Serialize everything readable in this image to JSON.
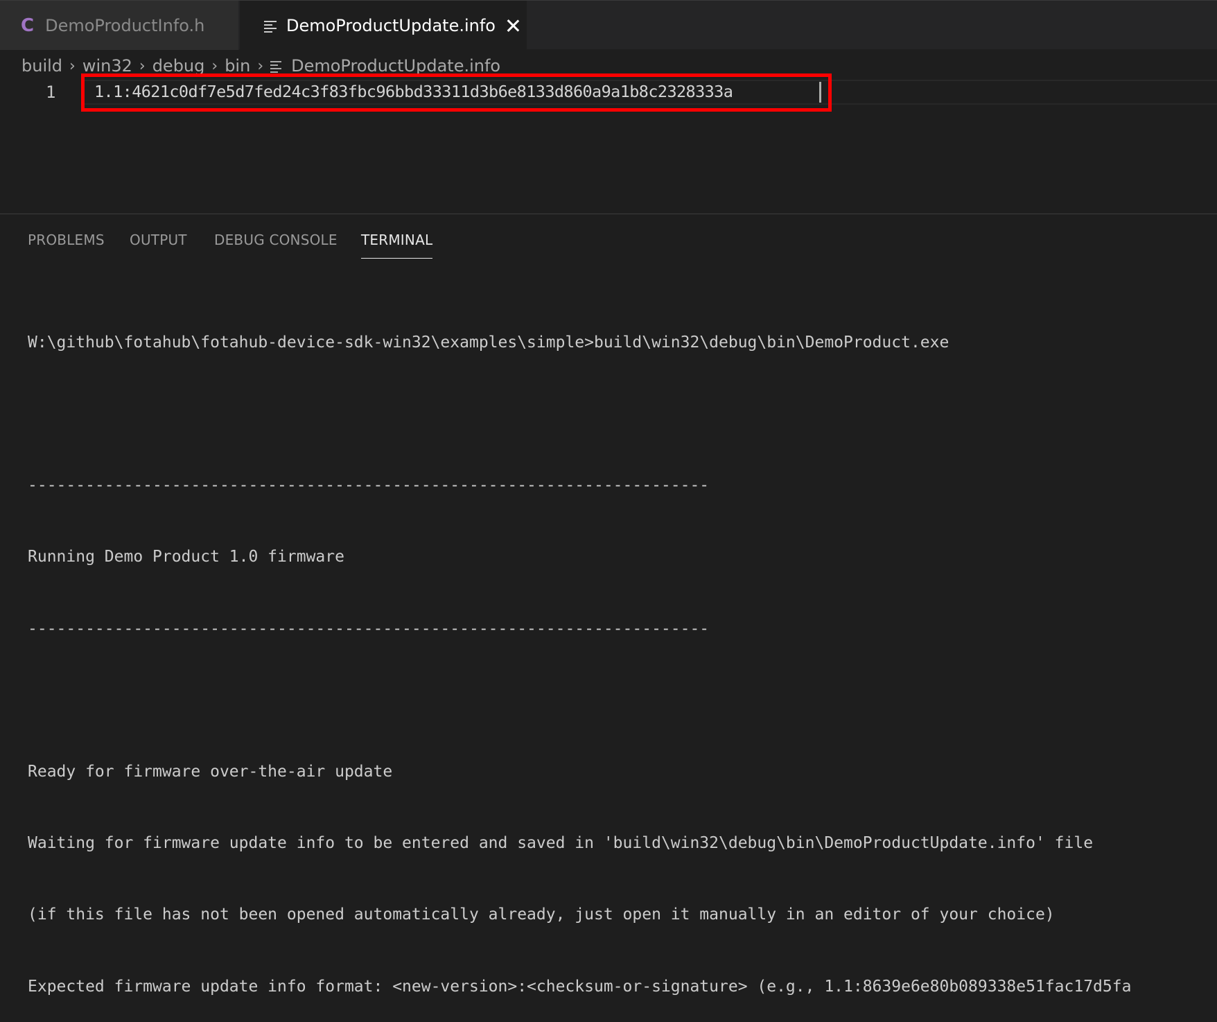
{
  "tabs": [
    {
      "label": "DemoProductInfo.h",
      "icon": "c-file-icon",
      "active": false
    },
    {
      "label": "DemoProductUpdate.info",
      "icon": "text-file-icon",
      "active": true
    }
  ],
  "breadcrumb": {
    "items": [
      "build",
      "win32",
      "debug",
      "bin"
    ],
    "file": "DemoProductUpdate.info"
  },
  "editor": {
    "line_number": "1",
    "line_text": "1.1:4621c0df7e5d7fed24c3f83fbc96bbd33311d3b6e8133d860a9a1b8c2328333a"
  },
  "panel": {
    "tabs": [
      "PROBLEMS",
      "OUTPUT",
      "DEBUG CONSOLE",
      "TERMINAL"
    ],
    "active_tab": "TERMINAL"
  },
  "terminal": {
    "lines": [
      "W:\\github\\fotahub\\fotahub-device-sdk-win32\\examples\\simple>build\\win32\\debug\\bin\\DemoProduct.exe",
      "",
      "-----------------------------------------------------------------------",
      "Running Demo Product 1.0 firmware",
      "-----------------------------------------------------------------------",
      "",
      "Ready for firmware over-the-air update",
      "Waiting for firmware update info to be entered and saved in 'build\\win32\\debug\\bin\\DemoProductUpdate.info' file",
      "(if this file has not been opened automatically already, just open it manually in an editor of your choice)",
      "Expected firmware update info format: <new-version>:<checksum-or-signature> (e.g., 1.1:8639e6e80b089338e51fac17d5fa"
    ]
  },
  "colors": {
    "highlight_box": "#ff0000",
    "c_icon": "#a074c4"
  }
}
